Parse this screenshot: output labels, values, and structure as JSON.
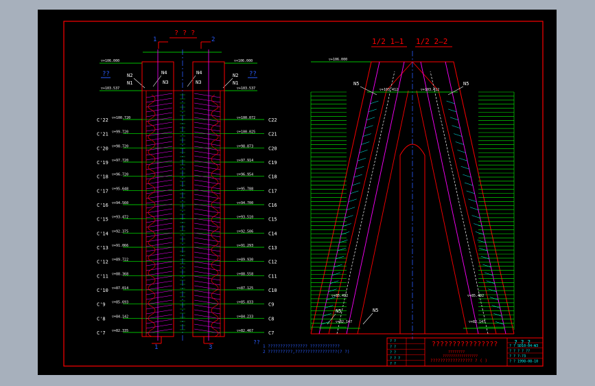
{
  "colors": {
    "background": "#a7b0bc",
    "sheet": "#000000",
    "border": "#ff0000",
    "green": "#00ff00",
    "white": "#ffffff",
    "magenta": "#ff00ff",
    "cyan": "#00ffff",
    "yellow": "#ffff00",
    "blue": "#2a5cff"
  },
  "left_elevation": {
    "title": "? ? ?",
    "section_marks": {
      "tl": "1",
      "tr": "2",
      "bl": "1",
      "br": "3"
    },
    "top_elev_left": "▽+106.000",
    "top_elev_right": "▽+106.000",
    "callouts": {
      "n1_left": "N1",
      "n2_left": "N2",
      "n4_left": "N4",
      "n4_mid": "N4",
      "n3_left": "N3",
      "n3_mid": "N3",
      "n1_right": "N1",
      "n2_right": "N2"
    },
    "side_q_left": "??",
    "side_q_right": "??",
    "mid_elev_left": "▽+103.537",
    "mid_elev_right": "▽+103.537",
    "levels_left": [
      {
        "code": "C'22",
        "elev": "▽+100.720"
      },
      {
        "code": "C'21",
        "elev": "▽+99.720"
      },
      {
        "code": "C'20",
        "elev": "▽+98.720"
      },
      {
        "code": "C'19",
        "elev": "▽+97.720"
      },
      {
        "code": "C'18",
        "elev": "▽+96.720"
      },
      {
        "code": "C'17",
        "elev": "▽+95.648"
      },
      {
        "code": "C'16",
        "elev": "▽+94.560"
      },
      {
        "code": "C'15",
        "elev": "▽+93.472"
      },
      {
        "code": "C'14",
        "elev": "▽+92.375"
      },
      {
        "code": "C'13",
        "elev": "▽+91.066"
      },
      {
        "code": "C'12",
        "elev": "▽+89.722"
      },
      {
        "code": "C'11",
        "elev": "▽+88.368"
      },
      {
        "code": "C'10",
        "elev": "▽+87.014"
      },
      {
        "code": "C'9",
        "elev": "▽+85.693"
      },
      {
        "code": "C'8",
        "elev": "▽+84.142"
      },
      {
        "code": "C'7",
        "elev": "▽+82.335"
      }
    ],
    "levels_right": [
      {
        "code": "C22",
        "elev": "▽+100.072"
      },
      {
        "code": "C21",
        "elev": "▽+100.025"
      },
      {
        "code": "C20",
        "elev": "▽+98.873"
      },
      {
        "code": "C19",
        "elev": "▽+97.914"
      },
      {
        "code": "C18",
        "elev": "▽+96.954"
      },
      {
        "code": "C17",
        "elev": "▽+95.788"
      },
      {
        "code": "C16",
        "elev": "▽+94.700"
      },
      {
        "code": "C15",
        "elev": "▽+93.510"
      },
      {
        "code": "C14",
        "elev": "▽+92.506"
      },
      {
        "code": "C13",
        "elev": "▽+91.293"
      },
      {
        "code": "C12",
        "elev": "▽+89.930"
      },
      {
        "code": "C11",
        "elev": "▽+88.558"
      },
      {
        "code": "C10",
        "elev": "▽+87.125"
      },
      {
        "code": "C9",
        "elev": "▽+85.833"
      },
      {
        "code": "C8",
        "elev": "▽+84.233"
      },
      {
        "code": "C7",
        "elev": "▽+82.467"
      }
    ]
  },
  "right_section": {
    "title_a": "1/2 1—1",
    "title_b": "1/2 2—2",
    "top_elev": "▽+106.000",
    "n5_tl": "N5",
    "n5_tr": "N5",
    "n5_bl": "N5",
    "n5_bm": "N5",
    "elev_upper_a": "▽+103.412",
    "elev_upper_b": "▽+103.412",
    "elev_lower_l": "▽+85.492",
    "elev_lower_r": "▽+85.492",
    "elev_bottom_l": "▽+82.147",
    "elev_bottom_r": "▽+82.147"
  },
  "notes": {
    "mark": "??",
    "line1": "1 ???????????????? ????????????",
    "line2": "2 ??????????,?????????????????(?  ?)"
  },
  "title_block": {
    "left_cells": [
      "?  ?",
      "?  ?",
      "?  ?",
      "? ? ?",
      "?  ?"
    ],
    "main_title": "????????????????",
    "sub_1": "????????",
    "sub_2": "?????????????????",
    "drawing_name": "?????????????????  ?  (  )",
    "right_header": "?  ?  ?",
    "right_rows": [
      "?  ?   SD10-04-W3",
      "?  ?   ?  ?    ??",
      "?  ?   ?-?3",
      "?  ?   1998-08-10"
    ]
  }
}
